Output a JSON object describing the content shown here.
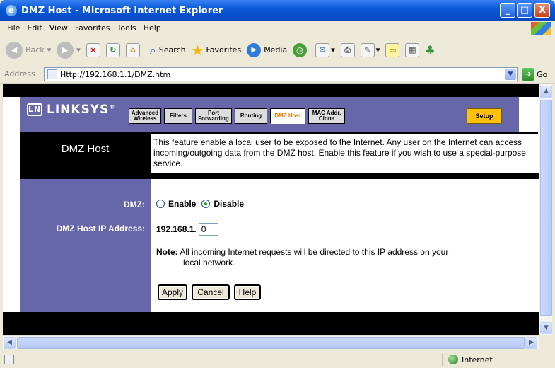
{
  "window": {
    "title": "DMZ Host - Microsoft Internet Explorer",
    "minimize": "_",
    "maximize": "□",
    "close": "X"
  },
  "menu": [
    "File",
    "Edit",
    "View",
    "Favorites",
    "Tools",
    "Help"
  ],
  "toolbar": {
    "back": "Back",
    "search": "Search",
    "favorites": "Favorites",
    "media": "Media"
  },
  "address": {
    "label": "Address",
    "url": "Http://192.168.1.1/DMZ.htm",
    "go": "Go"
  },
  "status": {
    "zone": "Internet"
  },
  "page": {
    "brand": "LINKSYS",
    "brand_mark": "LN",
    "tabs": [
      {
        "line1": "Advanced",
        "line2": "Wireless"
      },
      {
        "line1": "Filters",
        "line2": ""
      },
      {
        "line1": "Port",
        "line2": "Forwarding"
      },
      {
        "line1": "Routing",
        "line2": ""
      },
      {
        "line1": "DMZ Host",
        "line2": ""
      },
      {
        "line1": "MAC Addr.",
        "line2": "Clone"
      },
      {
        "line1": "Setup",
        "line2": ""
      }
    ],
    "title": "DMZ Host",
    "description": "This feature enable a local user to be exposed to the Internet. Any user on the Internet can access incoming/outgoing data from the DMZ host. Enable this feature if you wish to use a special-purpose service.",
    "dmz_label": "DMZ:",
    "enable_label": "Enable",
    "disable_label": "Disable",
    "dmz_state": "Disable",
    "ip_label": "DMZ Host IP Address:",
    "ip_prefix": "192.168.1.",
    "ip_value": "0",
    "note_bold": "Note:",
    "note_text": "All incoming Internet requests will be directed to this IP address on your",
    "note_text2": "local network.",
    "apply": "Apply",
    "cancel": "Cancel",
    "help": "Help"
  }
}
